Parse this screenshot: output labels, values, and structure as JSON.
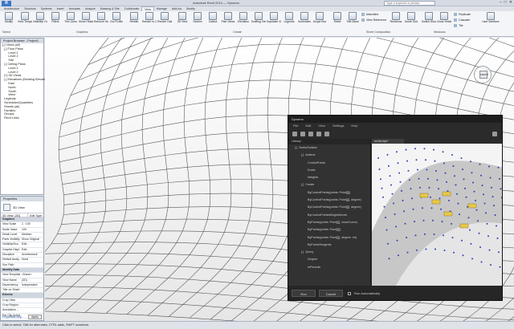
{
  "app": {
    "logo": "R",
    "title": "Autodesk Revit 2014 — Dynamo",
    "search_placeholder": "Type a keyword or phrase",
    "window_controls": [
      "–",
      "□",
      "✕"
    ]
  },
  "ribbon_tabs": [
    "Architecture",
    "Structure",
    "Systems",
    "Insert",
    "Annotate",
    "Analyze",
    "Massing & Site",
    "Collaborate",
    "View",
    "Manage",
    "Add-Ins",
    "Modify"
  ],
  "ribbon": {
    "modify": "Modify",
    "graphics_buttons": [
      "View Templates",
      "Visibility/ Graphics",
      "Filters",
      "Thin Lines",
      "Show Hidden Lines",
      "Remove Hidden Lines",
      "Cut Profile"
    ],
    "render_buttons": [
      "Render",
      "Render in Cloud",
      "Render Gallery"
    ],
    "create_buttons": [
      "3D View",
      "Section",
      "Callout",
      "Plan Views",
      "Elevation",
      "Drafting View",
      "Duplicate View",
      "Legends",
      "Schedules",
      "Scope Box"
    ],
    "sheet_buttons": [
      "Sheet",
      "Title Block",
      "Matchline",
      "View Reference",
      "Revisions",
      "Guide Grid"
    ],
    "windows_buttons": [
      "Switch Windows",
      "Close Hidden",
      "Replicate",
      "Cascade",
      "Tile"
    ],
    "ui_button": "User Interface",
    "groups": [
      "Select",
      "Graphics",
      "Create",
      "Sheet Composition",
      "Windows"
    ]
  },
  "browser": {
    "header": "Project Browser - Project1",
    "items": [
      "[-] Views (all)",
      "  [-] Floor Plans",
      "       Level 1",
      "       Level 2",
      "       Site",
      "  [-] Ceiling Plans",
      "       Level 1",
      "       Level 2",
      "  [+] 3D Views",
      "  [-] Elevations (Building Elevation)",
      "       East",
      "       North",
      "       South",
      "       West",
      "  Legends",
      "  Schedules/Quantities",
      "  Sheets (all)",
      "  Families",
      "  Groups",
      "  Revit Links"
    ]
  },
  "properties": {
    "header": "Properties",
    "type_name": "3D View",
    "selector": "3D View: {3D}",
    "edit_type": "Edit Type",
    "rows": [
      {
        "k": "Graphics",
        "v": "",
        "cat": true
      },
      {
        "k": "View Scale",
        "v": "1 : 100"
      },
      {
        "k": "Scale Value",
        "v": "100"
      },
      {
        "k": "Detail Level",
        "v": "Medium"
      },
      {
        "k": "Parts Visibility",
        "v": "Show Original"
      },
      {
        "k": "Visibility/Gra...",
        "v": "Edit..."
      },
      {
        "k": "Graphic Displ...",
        "v": "Edit..."
      },
      {
        "k": "Discipline",
        "v": "Architectural"
      },
      {
        "k": "Default Analy...",
        "v": "None"
      },
      {
        "k": "Sun Path",
        "v": ""
      },
      {
        "k": "Identity Data",
        "v": "",
        "cat": true
      },
      {
        "k": "View Template",
        "v": "<None>"
      },
      {
        "k": "View Name",
        "v": "{3D}"
      },
      {
        "k": "Dependency",
        "v": "Independent"
      },
      {
        "k": "Title on Sheet",
        "v": ""
      },
      {
        "k": "Extents",
        "v": "",
        "cat": true
      },
      {
        "k": "Crop View",
        "v": ""
      },
      {
        "k": "Crop Region ...",
        "v": ""
      },
      {
        "k": "Annotation ...",
        "v": ""
      },
      {
        "k": "Far Clip Active",
        "v": ""
      }
    ],
    "help_link": "Properties help",
    "apply": "Apply"
  },
  "viewcube": {
    "face": "FRONT"
  },
  "dynamo": {
    "title": "Dynamo",
    "menu": [
      "File",
      "Edit",
      "View",
      "Settings",
      "Help"
    ],
    "library_header": "Library",
    "canvas_tab": "revitcl.dyn*",
    "library_items": [
      {
        "label": "NurbsSurface",
        "indent": 1,
        "exp": "[-]"
      },
      {
        "label": "Actions",
        "indent": 2,
        "exp": "[-]"
      },
      {
        "label": "ControlPoints",
        "indent": 3
      },
      {
        "label": "Knots",
        "indent": 3
      },
      {
        "label": "Weights",
        "indent": 3
      },
      {
        "label": "Create",
        "indent": 2,
        "exp": "[-]"
      },
      {
        "label": "ByControlPoints(points: Point[][])",
        "indent": 3
      },
      {
        "label": "ByControlPoints(points: Point[][], degree)",
        "indent": 3
      },
      {
        "label": "ByControlPoints(points: Point[][], degree)",
        "indent": 3
      },
      {
        "label": "ByControlPointsWeightsKnots",
        "indent": 3
      },
      {
        "label": "ByPoints(points: Point[][], closeCurve)",
        "indent": 3
      },
      {
        "label": "ByPoints(points: Point[][])",
        "indent": 3
      },
      {
        "label": "ByPoints(points: Point[][], degree: int)",
        "indent": 3
      },
      {
        "label": "ByPointsTangents",
        "indent": 3
      },
      {
        "label": "Query",
        "indent": 2,
        "exp": "[-]"
      },
      {
        "label": "Degree",
        "indent": 3
      },
      {
        "label": "IsPeriodic",
        "indent": 3
      }
    ],
    "run": "Run",
    "cancel": "Cancel",
    "run_auto": "Run Automatically"
  },
  "status": {
    "text": "Click to select, TAB for alternates, CTRL adds, SHIFT unselects."
  }
}
